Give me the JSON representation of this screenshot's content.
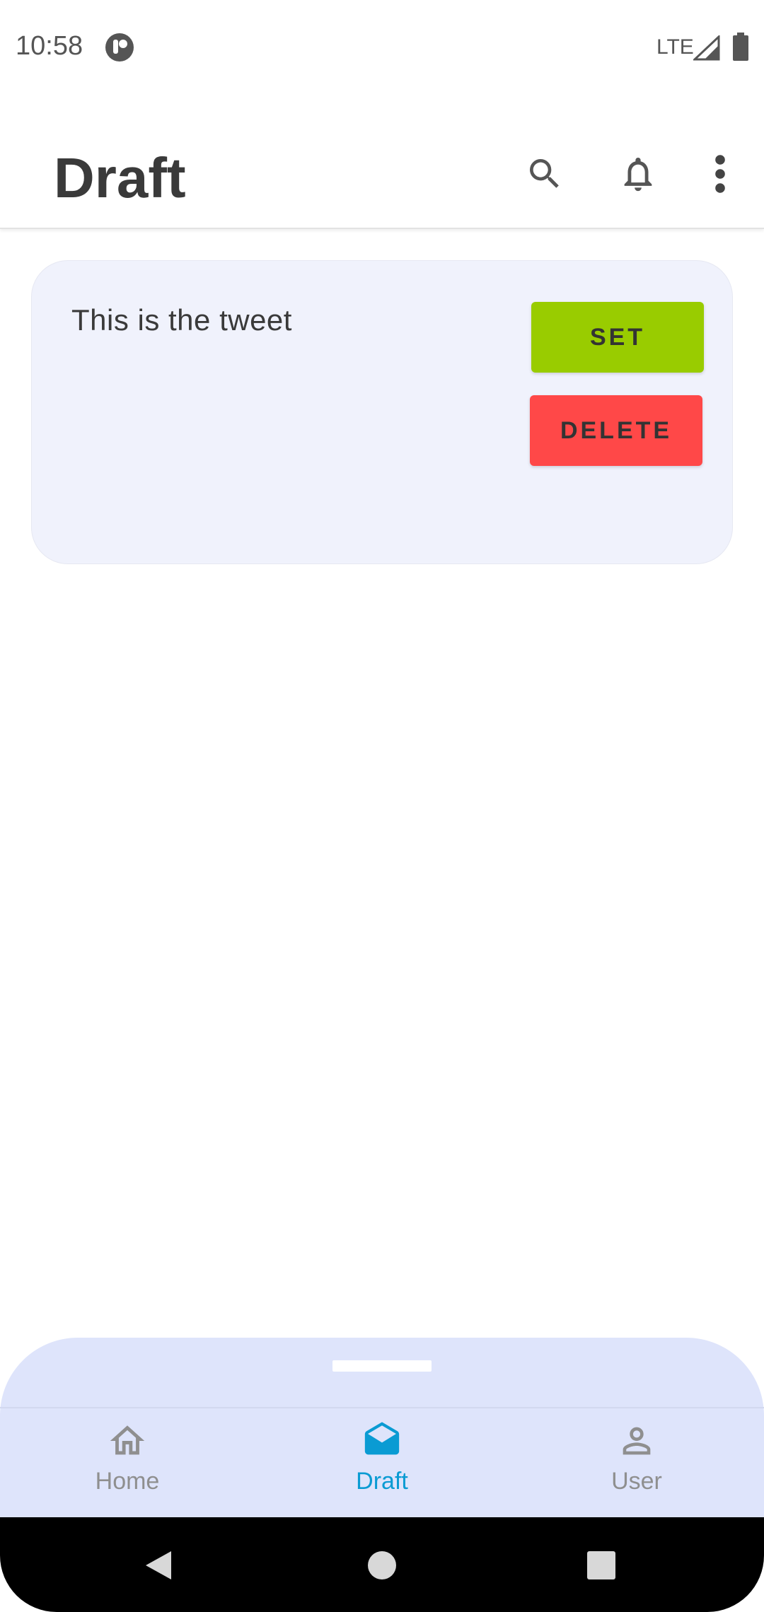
{
  "status_bar": {
    "time": "10:58",
    "network": "LTE"
  },
  "header": {
    "title": "Draft"
  },
  "draft": {
    "text": "This is the tweet",
    "set_label": "SET",
    "delete_label": "DELETE"
  },
  "nav": {
    "items": [
      {
        "label": "Home",
        "icon": "home-icon",
        "active": false
      },
      {
        "label": "Draft",
        "icon": "drafts-icon",
        "active": true
      },
      {
        "label": "User",
        "icon": "person-icon",
        "active": false
      }
    ]
  },
  "colors": {
    "set_button": "#99cc00",
    "delete_button": "#ff4848",
    "active_tab": "#0a9bd3",
    "inactive_tab": "#8f8f8f",
    "card_bg": "#f0f2fc",
    "sheet_bg": "#dee4fb"
  }
}
